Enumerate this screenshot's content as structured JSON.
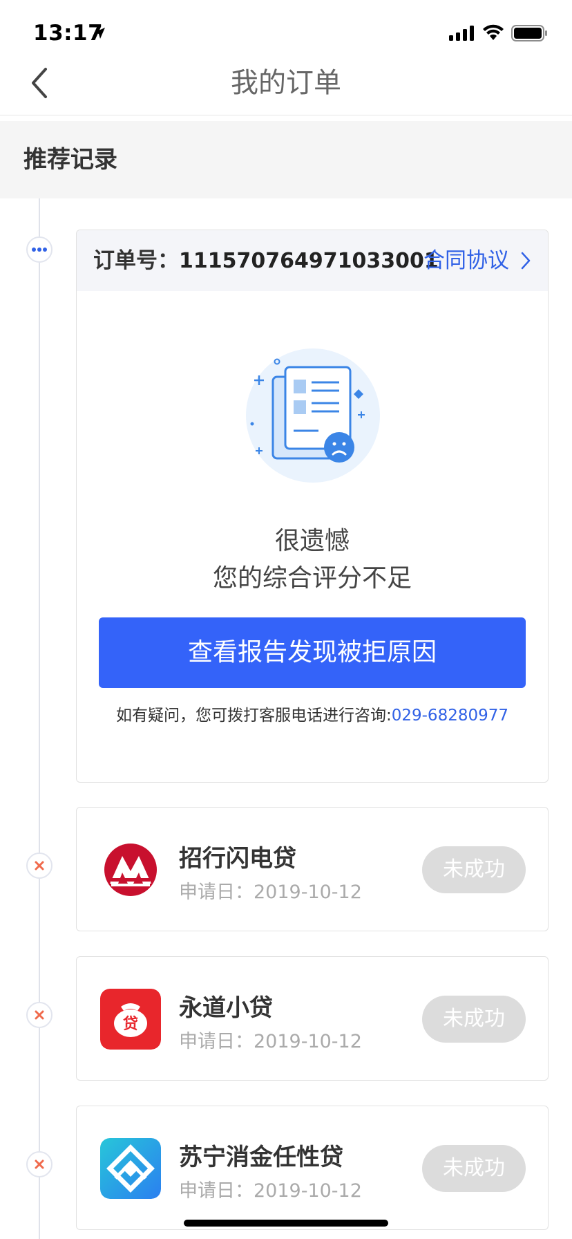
{
  "status_bar": {
    "time": "13:17"
  },
  "nav": {
    "title": "我的订单"
  },
  "section": {
    "title": "推荐记录"
  },
  "order": {
    "label": "订单号：",
    "number": "111570764971033001",
    "contract_link": "合同协议",
    "message_line1": "很遗憾",
    "message_line2": "您的综合评分不足",
    "report_button": "查看报告发现被拒原因",
    "hotline_prefix": "如有疑问，您可拨打客服电话进行咨询:",
    "hotline_number": "029-68280977"
  },
  "loans": [
    {
      "name": "招行闪电贷",
      "date": "申请日：2019-10-12",
      "status": "未成功",
      "logo_icon": "cmb-logo-icon"
    },
    {
      "name": "永道小贷",
      "date": "申请日：2019-10-12",
      "status": "未成功",
      "logo_icon": "loan-bag-logo-icon"
    },
    {
      "name": "苏宁消金任性贷",
      "date": "申请日：2019-10-12",
      "status": "未成功",
      "logo_icon": "suning-logo-icon"
    }
  ],
  "colors": {
    "accent": "#3463f9",
    "link": "#3061e6",
    "failed_pill": "#dcdcdc",
    "fail_mark": "#f06a4c"
  }
}
